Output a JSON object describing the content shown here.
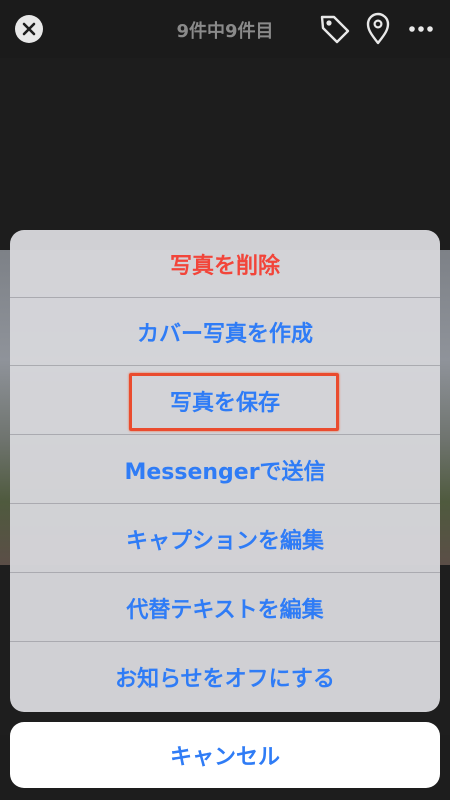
{
  "topbar": {
    "counter": "9件中9件目",
    "icons": [
      "close-icon",
      "tag-icon",
      "location-pin-icon",
      "more-icon"
    ]
  },
  "sheet": {
    "actions": [
      {
        "label": "写真を削除",
        "style": "destructive"
      },
      {
        "label": "カバー写真を作成",
        "style": "default"
      },
      {
        "label": "写真を保存",
        "style": "default",
        "highlighted": true
      },
      {
        "label": "Messengerで送信",
        "style": "default"
      },
      {
        "label": "キャプションを編集",
        "style": "default"
      },
      {
        "label": "代替テキストを編集",
        "style": "default"
      },
      {
        "label": "お知らせをオフにする",
        "style": "default"
      }
    ],
    "cancel_label": "キャンセル"
  },
  "colors": {
    "action_blue": "#2f7cf6",
    "destructive_red": "#f2453a",
    "highlight_border": "#ea4b2e"
  }
}
